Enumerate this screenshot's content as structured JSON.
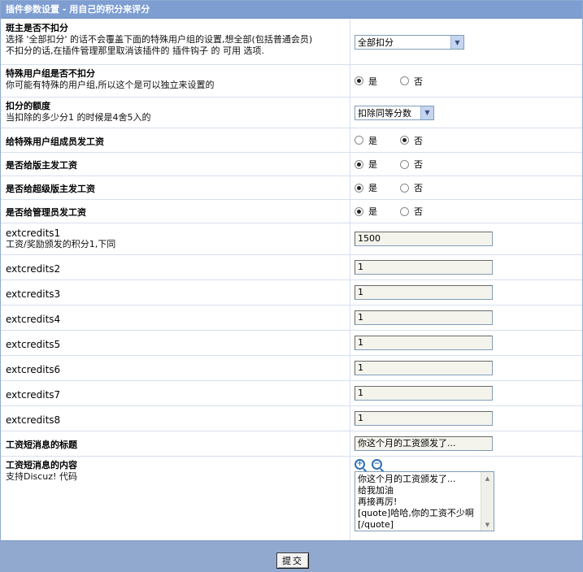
{
  "header": {
    "title": "插件参数设置 - 用自己的积分来评分"
  },
  "rows": {
    "r1": {
      "title": "斑主是否不扣分",
      "desc1": "选择 '全部扣分' 的话不会覆盖下面的特殊用户组的设置,想全部(包括普通会员)",
      "desc2": "不扣分的话,在插件管理那里取消该插件的 插件钩子 的 可用 选项.",
      "select_value": "全部扣分"
    },
    "r2": {
      "title": "特殊用户组是否不扣分",
      "desc": "你可能有特殊的用户组,所以这个是可以独立来设置的",
      "opt_yes": "是",
      "opt_no": "否"
    },
    "r3": {
      "title": "扣分的额度",
      "desc": "当扣除的多少分1 的时候是4舍5入的",
      "select_value": "扣除同等分数"
    },
    "r4": {
      "title": "给特殊用户组成员发工资",
      "opt_yes": "是",
      "opt_no": "否"
    },
    "r5": {
      "title": "是否给版主发工资",
      "opt_yes": "是",
      "opt_no": "否"
    },
    "r6": {
      "title": "是否给超级版主发工资",
      "opt_yes": "是",
      "opt_no": "否"
    },
    "r7": {
      "title": "是否给管理员发工资",
      "opt_yes": "是",
      "opt_no": "否"
    },
    "r8": {
      "title": "extcredits1",
      "desc": "工资/奖励颁发的积分1,下同",
      "value": "1500"
    },
    "r9": {
      "title": "extcredits2",
      "value": "1"
    },
    "r10": {
      "title": "extcredits3",
      "value": "1"
    },
    "r11": {
      "title": "extcredits4",
      "value": "1"
    },
    "r12": {
      "title": "extcredits5",
      "value": "1"
    },
    "r13": {
      "title": "extcredits6",
      "value": "1"
    },
    "r14": {
      "title": "extcredits7",
      "value": "1"
    },
    "r15": {
      "title": "extcredits8",
      "value": "1"
    },
    "r16": {
      "title": "工资短消息的标题",
      "value": "你这个月的工资颁发了..."
    },
    "r17": {
      "title": "工资短消息的内容",
      "desc": "支持Discuz! 代码",
      "lines": [
        "你这个月的工资颁发了...",
        "给我加油",
        "再接再厉!",
        "[quote]哈哈,你的工资不少啊",
        "[/quote]"
      ]
    }
  },
  "footer": {
    "submit_label": "提交"
  },
  "colors": {
    "header_bg": "#7e9ed2",
    "footer_bg": "#92a9cf"
  }
}
